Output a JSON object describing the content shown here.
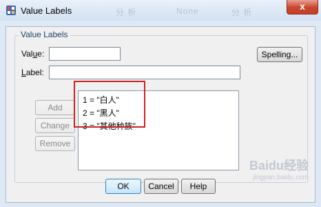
{
  "window": {
    "title": "Value Labels",
    "close_glyph": "x",
    "background_ghost_text": [
      "分 析",
      "None",
      "分 析"
    ]
  },
  "group": {
    "legend": "Value Labels"
  },
  "value_field": {
    "label_prefix": "Val",
    "label_underlined": "u",
    "label_suffix": "e:",
    "value": ""
  },
  "label_field": {
    "label_underlined": "L",
    "label_suffix": "abel:",
    "value": ""
  },
  "buttons": {
    "spelling": "Spelling...",
    "add": "Add",
    "change": "Change",
    "remove": "Remove",
    "ok": "OK",
    "cancel": "Cancel",
    "help": "Help"
  },
  "value_list": [
    "1 = \"白人\"",
    "2 = \"黑人\"",
    "3 = \"其他种族\""
  ],
  "watermark": {
    "main": "Baidu经验",
    "sub": "jingyan.baidu.com"
  },
  "colors": {
    "highlight_box": "#cc1f1f",
    "primary_button_border": "#3c7fb1",
    "close_button": "#c7402a"
  }
}
